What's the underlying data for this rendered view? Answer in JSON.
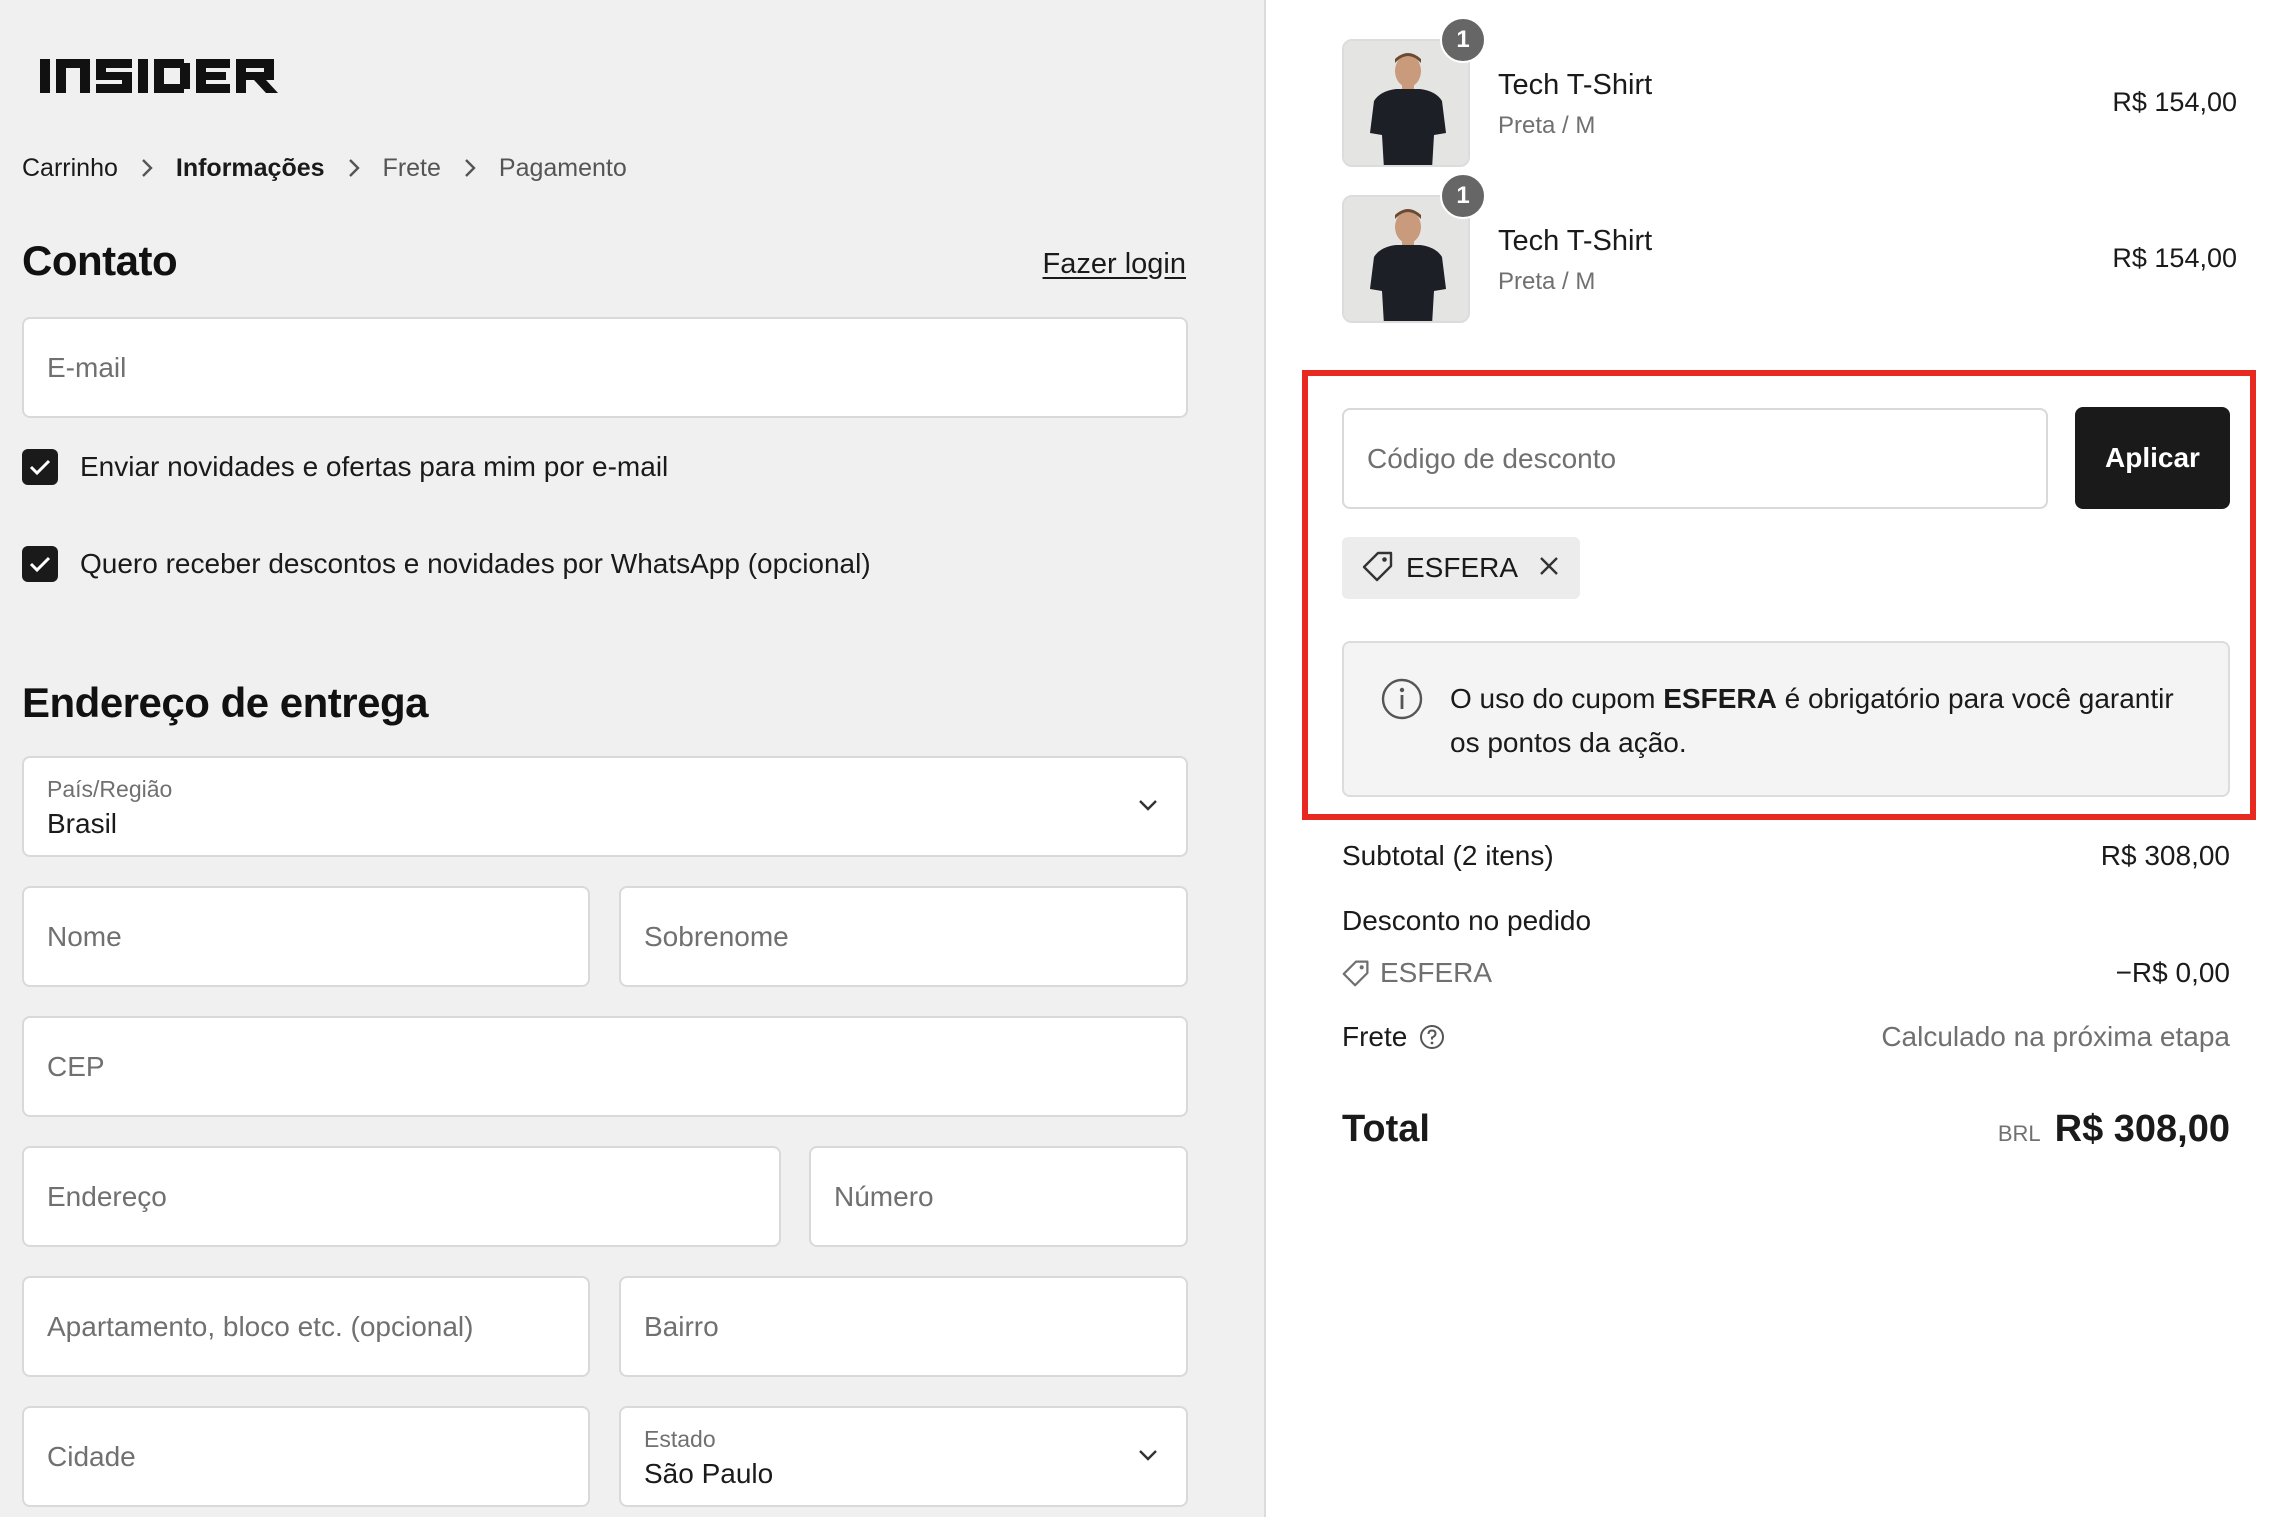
{
  "brand": {
    "logo_text": "INSIDER"
  },
  "breadcrumb": [
    "Carrinho",
    "Informações",
    "Frete",
    "Pagamento"
  ],
  "contact": {
    "title": "Contato",
    "login_link": "Fazer login",
    "email_placeholder": "E-mail",
    "newsletter_label": "Enviar novidades e ofertas para mim por e-mail",
    "newsletter_checked": true,
    "whatsapp_label": "Quero receber descontos e novidades por WhatsApp (opcional)",
    "whatsapp_checked": true
  },
  "shipping": {
    "title": "Endereço de entrega",
    "country_label": "País/Região",
    "country_value": "Brasil",
    "first_name_placeholder": "Nome",
    "last_name_placeholder": "Sobrenome",
    "cep_placeholder": "CEP",
    "address_placeholder": "Endereço",
    "number_placeholder": "Número",
    "apartment_placeholder": "Apartamento, bloco etc. (opcional)",
    "district_placeholder": "Bairro",
    "city_placeholder": "Cidade",
    "state_label": "Estado",
    "state_value": "São Paulo"
  },
  "cart_items": [
    {
      "name": "Tech T-Shirt",
      "variant": "Preta / M",
      "price": "R$ 154,00",
      "quantity": "1"
    },
    {
      "name": "Tech T-Shirt",
      "variant": "Preta / M",
      "price": "R$ 154,00",
      "quantity": "1"
    }
  ],
  "discount": {
    "placeholder": "Código de desconto",
    "apply_label": "Aplicar",
    "applied_code": "ESFERA",
    "notice_prefix": "O uso do cupom ",
    "notice_code": "ESFERA",
    "notice_suffix": " é obrigatório para você garantir os pontos da ação."
  },
  "summary": {
    "subtotal_label": "Subtotal (2 itens)",
    "subtotal_value": "R$ 308,00",
    "discount_label": "Desconto no pedido",
    "discount_code": "ESFERA",
    "discount_value": "−R$ 0,00",
    "shipping_label": "Frete",
    "shipping_value": "Calculado na próxima etapa",
    "total_label": "Total",
    "currency": "BRL",
    "total_value": "R$ 308,00"
  },
  "colors": {
    "highlight": "#e8291f",
    "button": "#1a1a1a",
    "panel_bg": "#f0f0f0"
  },
  "icons": [
    "chevron-right-icon",
    "check-icon",
    "chevron-down-icon",
    "tag-icon",
    "close-icon",
    "info-icon",
    "help-icon"
  ]
}
